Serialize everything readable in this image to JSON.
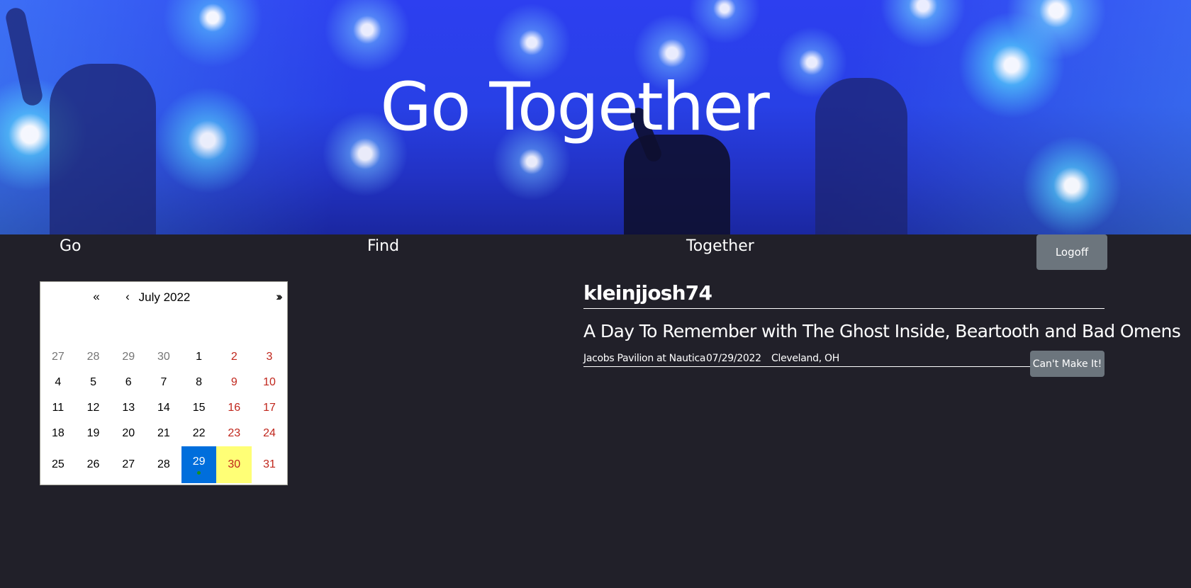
{
  "hero": {
    "title": "Go Together"
  },
  "nav": {
    "links": [
      "Go",
      "Find",
      "Together"
    ],
    "logoff_label": "Logoff"
  },
  "calendar": {
    "prev2": "«",
    "prev": "‹",
    "label": "July 2022",
    "next": "›",
    "next2": "»",
    "days": [
      "27",
      "28",
      "29",
      "30",
      "1",
      "2",
      "3",
      "4",
      "5",
      "6",
      "7",
      "8",
      "9",
      "10",
      "11",
      "12",
      "13",
      "14",
      "15",
      "16",
      "17",
      "18",
      "19",
      "20",
      "21",
      "22",
      "23",
      "24",
      "25",
      "26",
      "27",
      "28",
      "29",
      "30",
      "31"
    ],
    "active_day": "29",
    "today_day": "30",
    "colors": {
      "active": "#006edc",
      "today": "#ffff76",
      "weekend": "#c0261c"
    }
  },
  "profile": {
    "username": "kleinjjosh74",
    "event": {
      "title": "A Day To Remember with The Ghost Inside, Beartooth and Bad Omens",
      "venue": "Jacobs Pavilion at Nautica",
      "date": "07/29/2022",
      "location": "Cleveland, OH",
      "cancel_label": "Can't Make It!"
    }
  }
}
